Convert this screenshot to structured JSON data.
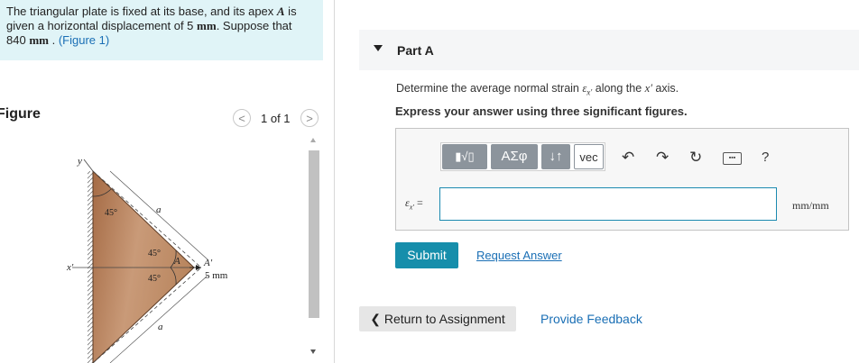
{
  "problem": {
    "line1": "The triangular plate is fixed at its base, and its apex ",
    "apex_var": "A",
    "line1b": " is",
    "line2a": "given a horizontal displacement of 5 ",
    "line2_unit": "mm",
    "line2b": ". Suppose that",
    "line3_value": "840 ",
    "line3_unit": "mm",
    "line3b": " . ",
    "figure_link": "(Figure 1)"
  },
  "figure": {
    "heading": "Figure",
    "pager": "1 of 1",
    "prev_icon": "chevron-left-icon",
    "next_icon": "chevron-right-icon",
    "labels": {
      "y": "y",
      "x_prime": "x′",
      "angle_top": "45°",
      "angle_mid_upper": "45°",
      "angle_mid_lower": "45°",
      "a_upper": "a",
      "a_lower": "a",
      "apex": "A",
      "apex_prime": "A′",
      "displacement": "5 mm"
    }
  },
  "part": {
    "title": "Part A",
    "question_pre": "Determine the average normal strain ",
    "question_symbol": "ε",
    "question_sub": "x′",
    "question_mid": " along the ",
    "question_axis": "x′",
    "question_post": " axis.",
    "instruction": "Express your answer using three significant figures."
  },
  "toolbar": {
    "templates_icon": "templates-icon",
    "greek_label": "ΑΣφ",
    "arrows_label": "↓↑",
    "vec_label": "vec",
    "undo_icon": "undo-icon",
    "redo_icon": "redo-icon",
    "reset_icon": "reset-icon",
    "keyboard_icon": "keyboard-icon",
    "help_label": "?"
  },
  "answer": {
    "label_symbol": "ε",
    "label_sub": "x′",
    "label_eq": " =",
    "value": "",
    "unit": "mm/mm"
  },
  "actions": {
    "submit": "Submit",
    "request": "Request Answer",
    "return": "Return to Assignment",
    "return_icon": "chevron-left-icon",
    "feedback": "Provide Feedback"
  },
  "colors": {
    "accent": "#168eab",
    "link": "#1a6fb5",
    "problem_bg": "#e0f4f7",
    "plate": "#b07a55"
  }
}
